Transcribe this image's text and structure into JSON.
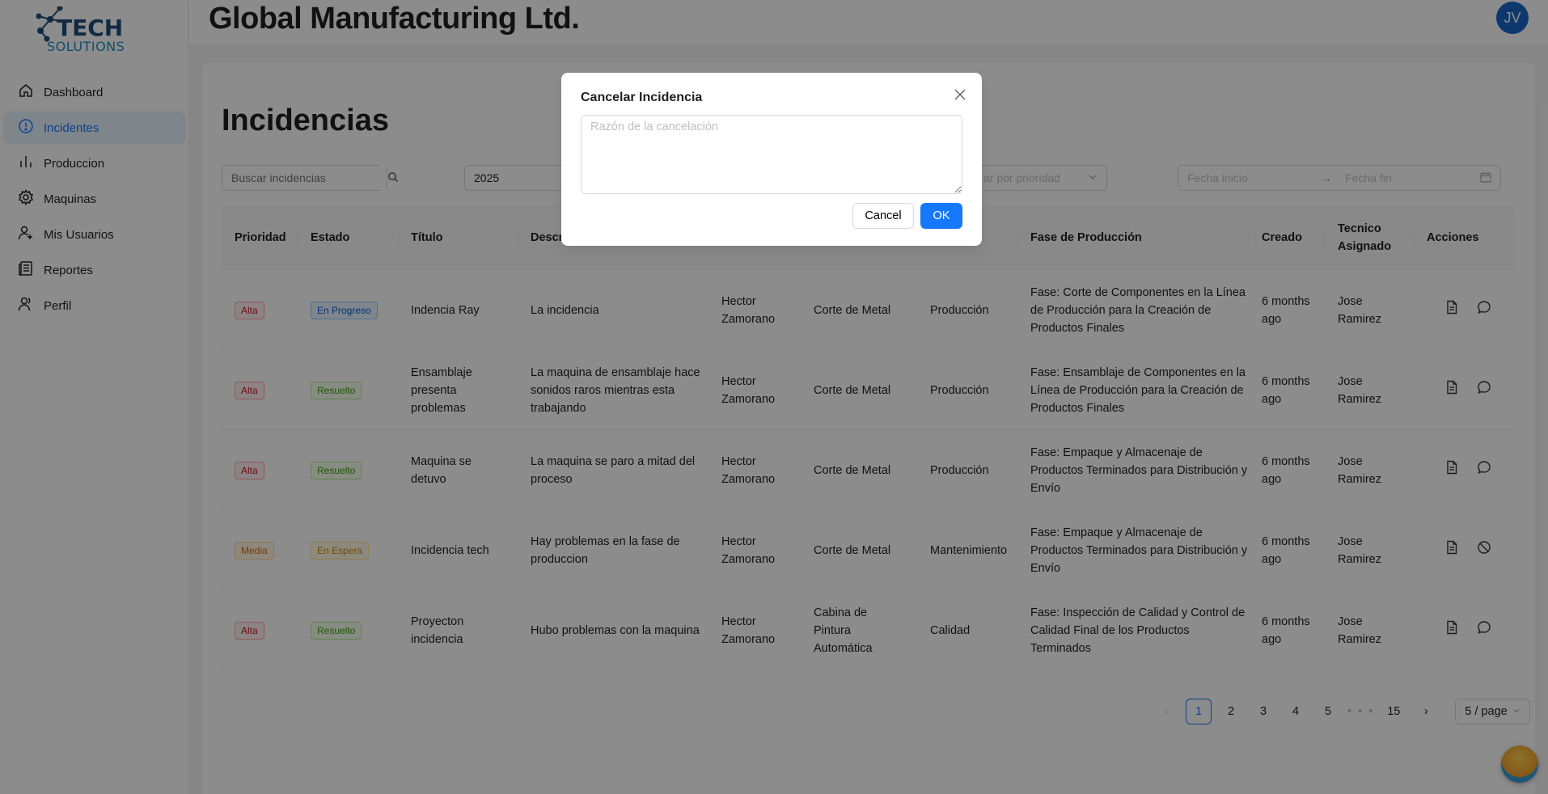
{
  "brand": {
    "logo_line1": "TECH",
    "logo_line2": "SOLUTIONS",
    "accent": "#1677ff"
  },
  "sidebar": {
    "items": [
      {
        "label": "Dashboard",
        "icon": "home-icon",
        "active": false
      },
      {
        "label": "Incidentes",
        "icon": "exclamation-circle-icon",
        "active": true
      },
      {
        "label": "Produccion",
        "icon": "bar-chart-icon",
        "active": false
      },
      {
        "label": "Maquinas",
        "icon": "gear-icon",
        "active": false
      },
      {
        "label": "Mis Usuarios",
        "icon": "user-add-icon",
        "active": false
      },
      {
        "label": "Reportes",
        "icon": "report-icon",
        "active": false
      },
      {
        "label": "Perfil",
        "icon": "user-icon",
        "active": false
      }
    ]
  },
  "header": {
    "company": "Global Manufacturing Ltd.",
    "avatar_initials": "JV"
  },
  "main": {
    "title": "Incidencias",
    "filters": {
      "search_placeholder": "Buscar incidencias",
      "year": "2025",
      "priority_placeholder": "ar por prioridad",
      "date_start_placeholder": "Fecha inicio",
      "date_end_placeholder": "Fecha fin"
    },
    "columns": [
      "Prioridad",
      "Estado",
      "Título",
      "Descr",
      "",
      "",
      "",
      "Fase de Producción",
      "Creado",
      "Tecnico Asignado",
      "Acciones"
    ],
    "rows": [
      {
        "priority": "Alta",
        "priority_color": "red",
        "status": "En Progreso",
        "status_color": "blue",
        "title": "Indencia Ray",
        "description": "La incidencia",
        "reporter": "Hector Zamorano",
        "machine": "Corte de Metal",
        "area": "Producción",
        "phase": "Fase: Corte de Componentes en la Línea de Producción para la Creación de Productos Finales",
        "created": "6 months ago",
        "technician": "Jose Ramirez",
        "second_action": "comment-icon"
      },
      {
        "priority": "Alta",
        "priority_color": "red",
        "status": "Resuelto",
        "status_color": "green",
        "title": "Ensamblaje presenta problemas",
        "description": "La maquina de ensamblaje hace sonidos raros mientras esta trabajando",
        "reporter": "Hector Zamorano",
        "machine": "Corte de Metal",
        "area": "Producción",
        "phase": "Fase: Ensamblaje de Componentes en la Línea de Producción para la Creación de Productos Finales",
        "created": "6 months ago",
        "technician": "Jose Ramirez",
        "second_action": "comment-icon"
      },
      {
        "priority": "Alta",
        "priority_color": "red",
        "status": "Resuelto",
        "status_color": "green",
        "title": "Maquina se detuvo",
        "description": "La maquina se paro a mitad del proceso",
        "reporter": "Hector Zamorano",
        "machine": "Corte de Metal",
        "area": "Producción",
        "phase": "Fase: Empaque y Almacenaje de Productos Terminados para Distribución y Envío",
        "created": "6 months ago",
        "technician": "Jose Ramirez",
        "second_action": "comment-icon"
      },
      {
        "priority": "Media",
        "priority_color": "orange",
        "status": "En Espera",
        "status_color": "gold",
        "title": "Incidencia tech",
        "description": "Hay problemas en la fase de produccion",
        "reporter": "Hector Zamorano",
        "machine": "Corte de Metal",
        "area": "Mantenimiento",
        "phase": "Fase: Empaque y Almacenaje de Productos Terminados para Distribución y Envío",
        "created": "6 months ago",
        "technician": "Jose Ramirez",
        "second_action": "stop-icon"
      },
      {
        "priority": "Alta",
        "priority_color": "red",
        "status": "Resuelto",
        "status_color": "green",
        "title": "Proyecton incidencia",
        "description": "Hubo problemas con la maquina",
        "reporter": "Hector Zamorano",
        "machine": "Cabina de Pintura Automática",
        "area": "Calidad",
        "phase": "Fase: Inspección de Calidad y Control de Calidad Final de los Productos Terminados",
        "created": "6 months ago",
        "technician": "Jose Ramirez",
        "second_action": "comment-icon"
      }
    ],
    "pagination": {
      "pages": [
        "1",
        "2",
        "3",
        "4",
        "5"
      ],
      "ellipsis": "• • •",
      "last": "15",
      "current": "1",
      "page_size": "5 / page"
    }
  },
  "modal": {
    "title": "Cancelar Incidencia",
    "placeholder": "Razón de la cancelación",
    "cancel_label": "Cancel",
    "ok_label": "OK"
  }
}
